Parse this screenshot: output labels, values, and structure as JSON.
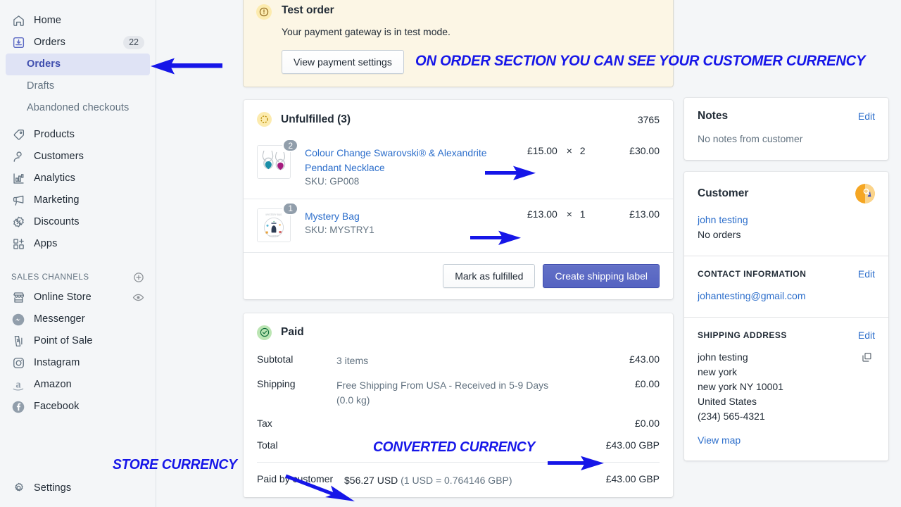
{
  "sidebar": {
    "items": [
      {
        "label": "Home",
        "icon": "home-icon"
      },
      {
        "label": "Orders",
        "icon": "orders-inbox-icon",
        "badge": "22"
      },
      {
        "label": "Orders",
        "icon": "none",
        "sub": true,
        "active": true
      },
      {
        "label": "Drafts",
        "icon": "none",
        "sub": true
      },
      {
        "label": "Abandoned checkouts",
        "icon": "none",
        "sub": true
      },
      {
        "label": "Products",
        "icon": "tag-icon"
      },
      {
        "label": "Customers",
        "icon": "person-icon"
      },
      {
        "label": "Analytics",
        "icon": "bar-chart-icon"
      },
      {
        "label": "Marketing",
        "icon": "megaphone-icon"
      },
      {
        "label": "Discounts",
        "icon": "discount-percent-icon"
      },
      {
        "label": "Apps",
        "icon": "apps-grid-icon"
      }
    ],
    "sales_channels_header": "SALES CHANNELS",
    "channels": [
      {
        "label": "Online Store",
        "icon": "storefront-icon",
        "trailing": "eye-icon"
      },
      {
        "label": "Messenger",
        "icon": "messenger-icon"
      },
      {
        "label": "Point of Sale",
        "icon": "point-of-sale-icon"
      },
      {
        "label": "Instagram",
        "icon": "instagram-icon"
      },
      {
        "label": "Amazon",
        "icon": "amazon-icon"
      },
      {
        "label": "Facebook",
        "icon": "facebook-icon"
      }
    ],
    "settings": {
      "label": "Settings",
      "icon": "gear-icon"
    }
  },
  "banner": {
    "icon": "warning-exclamation-icon",
    "title": "Test order",
    "body": "Your payment gateway is in test mode.",
    "button": "View payment settings"
  },
  "fulfillment": {
    "icon": "dashed-circle-icon",
    "title": "Unfulfilled (3)",
    "tracking_number": "3765",
    "items": [
      {
        "qty_badge": "2",
        "name": "Colour Change Swarovski® & Alexandrite Pendant Necklace",
        "sku": "SKU: GP008",
        "unit_price": "£15.00",
        "times": "×",
        "quantity": "2",
        "line_total": "£30.00",
        "thumb": "pendant-necklaces-photo"
      },
      {
        "qty_badge": "1",
        "name": "Mystery Bag",
        "sku": "SKU: MYSTRY1",
        "unit_price": "£13.00",
        "times": "×",
        "quantity": "1",
        "line_total": "£13.00",
        "thumb": "mystery-bag-photo"
      }
    ],
    "secondary_button": "Mark as fulfilled",
    "primary_button": "Create shipping label"
  },
  "payment": {
    "icon": "check-circle-icon",
    "status": "Paid",
    "rows": [
      {
        "key": "Subtotal",
        "detail": "3 items",
        "value": "£43.00"
      },
      {
        "key": "Shipping",
        "detail": "Free Shipping From USA - Received in 5-9 Days (0.0 kg)",
        "value": "£0.00"
      },
      {
        "key": "Tax",
        "detail": "",
        "value": "£0.00"
      },
      {
        "key": "Total",
        "detail": "",
        "value": "£43.00 GBP"
      }
    ],
    "paid_by": {
      "key": "Paid by customer",
      "amount": "$56.27 USD",
      "rate": "(1 USD = 0.764146 GBP)",
      "value": "£43.00 GBP"
    }
  },
  "notes": {
    "title": "Notes",
    "edit": "Edit",
    "body": "No notes from customer"
  },
  "customer": {
    "title": "Customer",
    "avatar": "customer-avatar-icon",
    "name": "john testing",
    "orders": "No orders"
  },
  "contact": {
    "title": "CONTACT INFORMATION",
    "edit": "Edit",
    "email": "johantesting@gmail.com"
  },
  "shipping": {
    "title": "SHIPPING ADDRESS",
    "edit": "Edit",
    "copy_icon": "copy-icon",
    "lines": [
      "john testing",
      "new york",
      "new york NY 10001",
      "United States",
      "(234) 565-4321"
    ],
    "view_map": "View map"
  },
  "annotations": {
    "color": "#1616e8",
    "order_section": "ON ORDER SECTION YOU CAN SEE YOUR CUSTOMER CURRENCY",
    "store_currency": "STORE CURRENCY",
    "converted_currency": "CONVERTED CURRENCY"
  }
}
